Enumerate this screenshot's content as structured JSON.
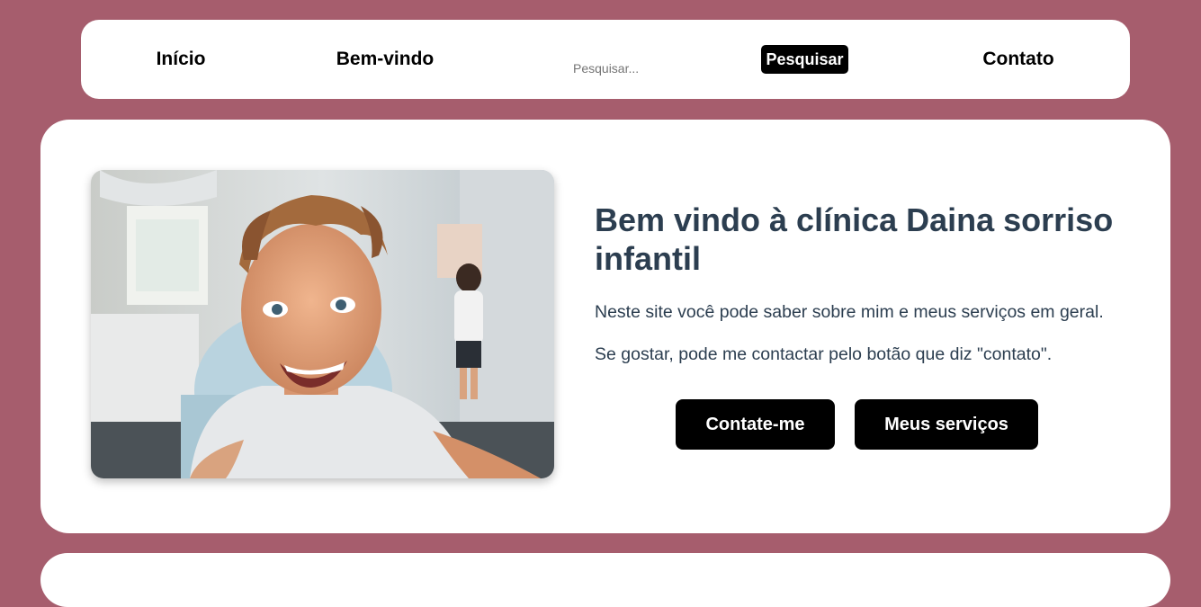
{
  "nav": {
    "home_label": "Início",
    "welcome_label": "Bem-vindo",
    "search_placeholder": "Pesquisar...",
    "search_button_label": "Pesquisar",
    "contact_label": "Contato"
  },
  "hero": {
    "title": "Bem vindo à clínica Daina sorriso infantil",
    "paragraph_1": "Neste site você pode saber sobre mim e meus serviços em geral.",
    "paragraph_2": "Se gostar, pode me contactar pelo botão que diz \"contato\".",
    "contact_button_label": "Contate-me",
    "services_button_label": "Meus serviços",
    "image_icon": "child-dental-chair-photo"
  },
  "colors": {
    "page_background": "#a65d6d",
    "card_background": "#ffffff",
    "title_color": "#2c3e50",
    "button_background": "#000000",
    "button_text": "#ffffff"
  }
}
